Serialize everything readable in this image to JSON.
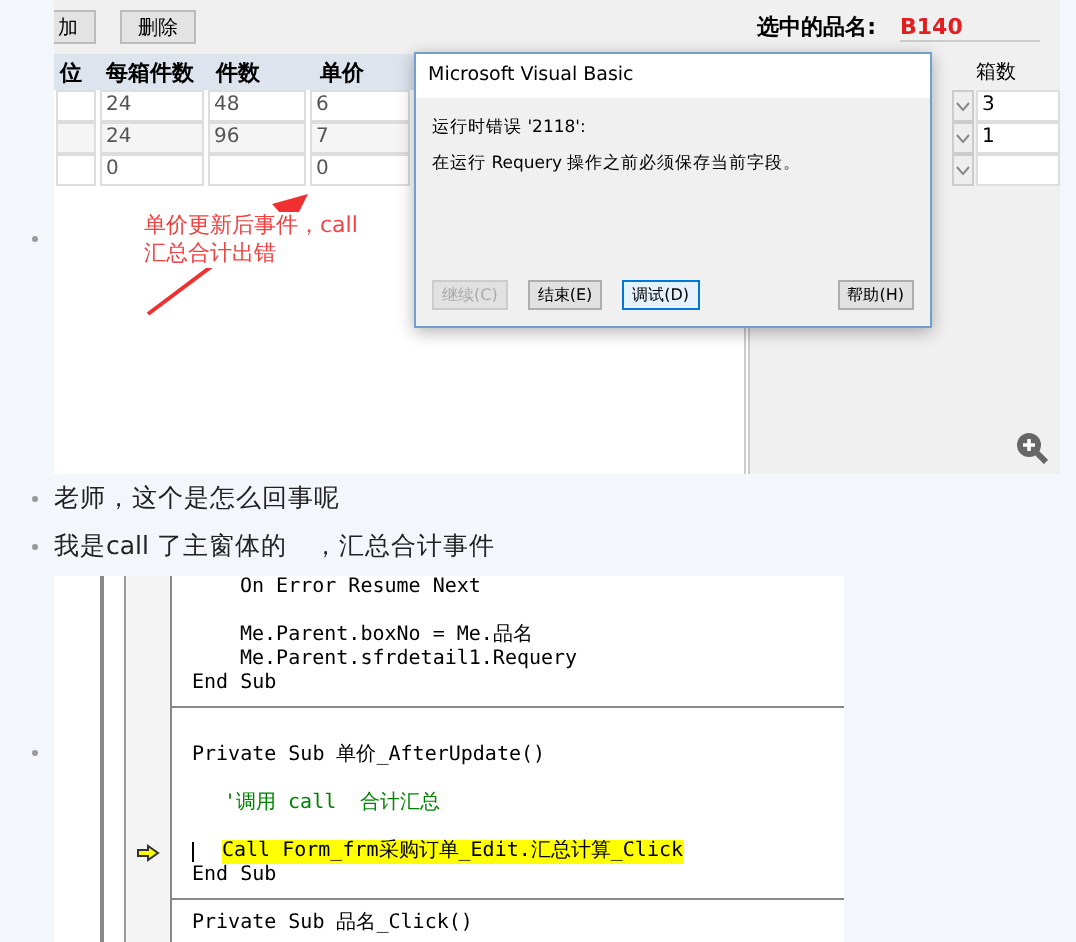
{
  "screenshot": {
    "toolbar_buttons": [
      "加",
      "删除"
    ],
    "selected_name_label": "选中的品名:",
    "selected_name_value": "B140",
    "grid": {
      "columns": [
        "位",
        "每箱件数",
        "件数",
        "单价"
      ],
      "rows": [
        [
          null,
          "24",
          "48",
          "6"
        ],
        [
          null,
          "24",
          "96",
          "7"
        ],
        [
          null,
          "0",
          null,
          "0"
        ]
      ]
    },
    "right_grid": {
      "column": "箱数",
      "rows": [
        "3",
        "1",
        null
      ]
    },
    "annotation": "单价更新后事件，call 汇总合计出错",
    "dialog": {
      "title": "Microsoft Visual Basic",
      "message_lines": [
        "运行时错误 '2118':",
        "在运行 Requery 操作之前必须保存当前字段。"
      ],
      "buttons": [
        {
          "label": "继续(C)",
          "disabled": true,
          "selected": false
        },
        {
          "label": "结束(E)",
          "disabled": false,
          "selected": false
        },
        {
          "label": "调试(D)",
          "disabled": false,
          "selected": true
        },
        {
          "label": "帮助(H)",
          "disabled": false,
          "selected": false
        }
      ]
    }
  },
  "comments": [
    "老师，这个是怎么回事呢",
    "我是call 了主窗体的　，汇总合计事件"
  ],
  "code_window": {
    "lines": [
      {
        "kind": "statement",
        "text": "On Error Resume Next"
      },
      {
        "kind": "blank"
      },
      {
        "kind": "statement",
        "text": "Me.Parent.boxNo = Me.品名"
      },
      {
        "kind": "statement",
        "text": "Me.Parent.sfrdetail1.Requery"
      },
      {
        "kind": "end",
        "text": "End Sub"
      },
      {
        "kind": "blank"
      },
      {
        "kind": "declaration",
        "text": "Private Sub 单价_AfterUpdate()"
      },
      {
        "kind": "blank"
      },
      {
        "kind": "comment",
        "text": "'调用 call  合计汇总"
      },
      {
        "kind": "blank"
      },
      {
        "kind": "current",
        "text": "Call Form_frm采购订单_Edit.汇总计算_Click"
      },
      {
        "kind": "end",
        "text": "End Sub"
      },
      {
        "kind": "declaration",
        "text": "Private Sub 品名_Click()"
      }
    ]
  }
}
